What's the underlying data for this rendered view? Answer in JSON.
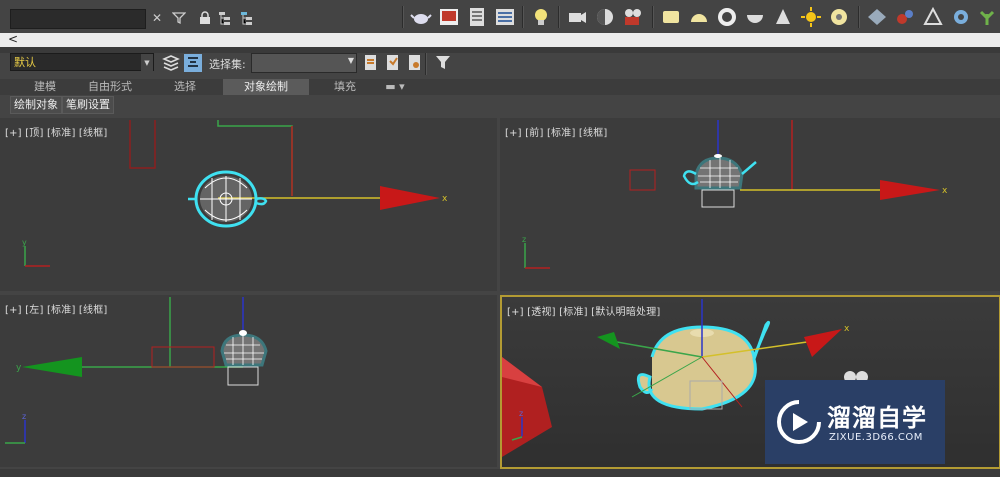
{
  "toolbar": {
    "search_placeholder": "",
    "icons": [
      "close-icon",
      "filter-icon",
      "lock-icon",
      "hierarchy-icon",
      "hierarchy-alt-icon",
      "teapot-render-icon",
      "render-frame-icon",
      "list-icon",
      "panel-icon",
      "light-bulb-icon",
      "camera-icon",
      "sphere-half-icon",
      "video-camera-icon",
      "rectangle-icon",
      "dome-icon",
      "ring-icon",
      "bowl-icon",
      "cone-icon",
      "sun-icon",
      "disc-icon",
      "grid-icon",
      "particle-icon",
      "shape-icon",
      "gear-icon",
      "plant-icon"
    ]
  },
  "strip": {
    "arrow": "<"
  },
  "setbar": {
    "layer_value": "默认",
    "selection_set_label": "选择集:",
    "selection_set_value": ""
  },
  "tabs": [
    {
      "label": "建模"
    },
    {
      "label": "自由形式"
    },
    {
      "label": "选择"
    },
    {
      "label": "对象绘制"
    },
    {
      "label": "填充"
    }
  ],
  "subtabs": [
    {
      "label": "绘制对象"
    },
    {
      "label": "笔刷设置"
    }
  ],
  "viewports": {
    "top": {
      "label": "[+] [顶] [标准] [线框]"
    },
    "front": {
      "label": "[+] [前] [标准] [线框]"
    },
    "left": {
      "label": "[+] [左] [标准] [线框]"
    },
    "perspective": {
      "label": "[+] [透视] [标准] [默认明暗处理]"
    }
  },
  "axis_labels": {
    "x": "x",
    "y": "y",
    "z": "z"
  },
  "watermark": {
    "title": "溜溜自学",
    "url": "ZIXUE.3D66.COM"
  },
  "colors": {
    "accent_yellow": "#e8cc46",
    "active_viewport_border": "#b39b33",
    "watermark_bg": "#2a3f66"
  }
}
